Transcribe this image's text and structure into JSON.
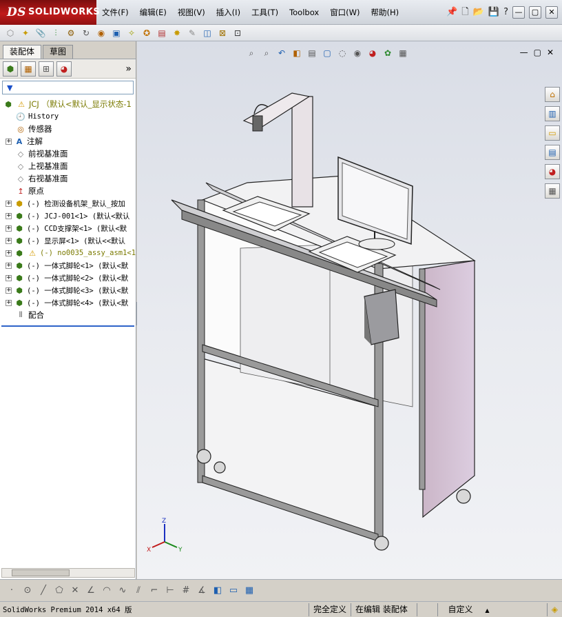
{
  "app": {
    "brand_ds": "DS",
    "brand_name": "SOLIDWORKS"
  },
  "menu": [
    "文件(F)",
    "编辑(E)",
    "视图(V)",
    "插入(I)",
    "工具(T)",
    "Toolbox",
    "窗口(W)",
    "帮助(H)"
  ],
  "window_controls": {
    "pin": "📌",
    "new": "🗋",
    "open": "📂",
    "save": "💾",
    "help": "?",
    "minimize": "—",
    "restore": "▢",
    "close": "✕"
  },
  "left_panel": {
    "tabs": [
      "装配体",
      "草图"
    ],
    "more": "»",
    "filter_icon": "▼",
    "tree": [
      {
        "type": "root",
        "label": "JCJ  （默认<默认_显示状态-1"
      },
      {
        "type": "leaf",
        "label": "History"
      },
      {
        "type": "leaf",
        "label": "传感器"
      },
      {
        "type": "expand",
        "label": "注解"
      },
      {
        "type": "leaf",
        "label": "前视基准面"
      },
      {
        "type": "leaf",
        "label": "上视基准面"
      },
      {
        "type": "leaf",
        "label": "右视基准面"
      },
      {
        "type": "leaf",
        "label": "原点"
      },
      {
        "type": "component",
        "label": "(-) 检测设备机架_默认_按加"
      },
      {
        "type": "component",
        "label": "(-) JCJ-001<1> (默认<默认"
      },
      {
        "type": "component",
        "label": "(-) CCD支撑架<1> (默认<默"
      },
      {
        "type": "component",
        "label": "(-) 显示屏<1> (默认<<默认"
      },
      {
        "type": "component_warn",
        "label": "(-) no0035_assy_asm1<1>"
      },
      {
        "type": "component",
        "label": "(-) 一体式脚轮<1> (默认<默"
      },
      {
        "type": "component",
        "label": "(-) 一体式脚轮<2> (默认<默"
      },
      {
        "type": "component",
        "label": "(-) 一体式脚轮<3> (默认<默"
      },
      {
        "type": "component",
        "label": "(-) 一体式脚轮<4> (默认<默"
      },
      {
        "type": "mates",
        "label": "配合"
      }
    ]
  },
  "triad": {
    "x": "X",
    "y": "Y",
    "z": "Z"
  },
  "status": {
    "app_version": "SolidWorks Premium 2014 x64 版",
    "fully_defined": "完全定义",
    "editing": "在编辑 装配体",
    "custom": "自定义",
    "arrow": "▲"
  }
}
